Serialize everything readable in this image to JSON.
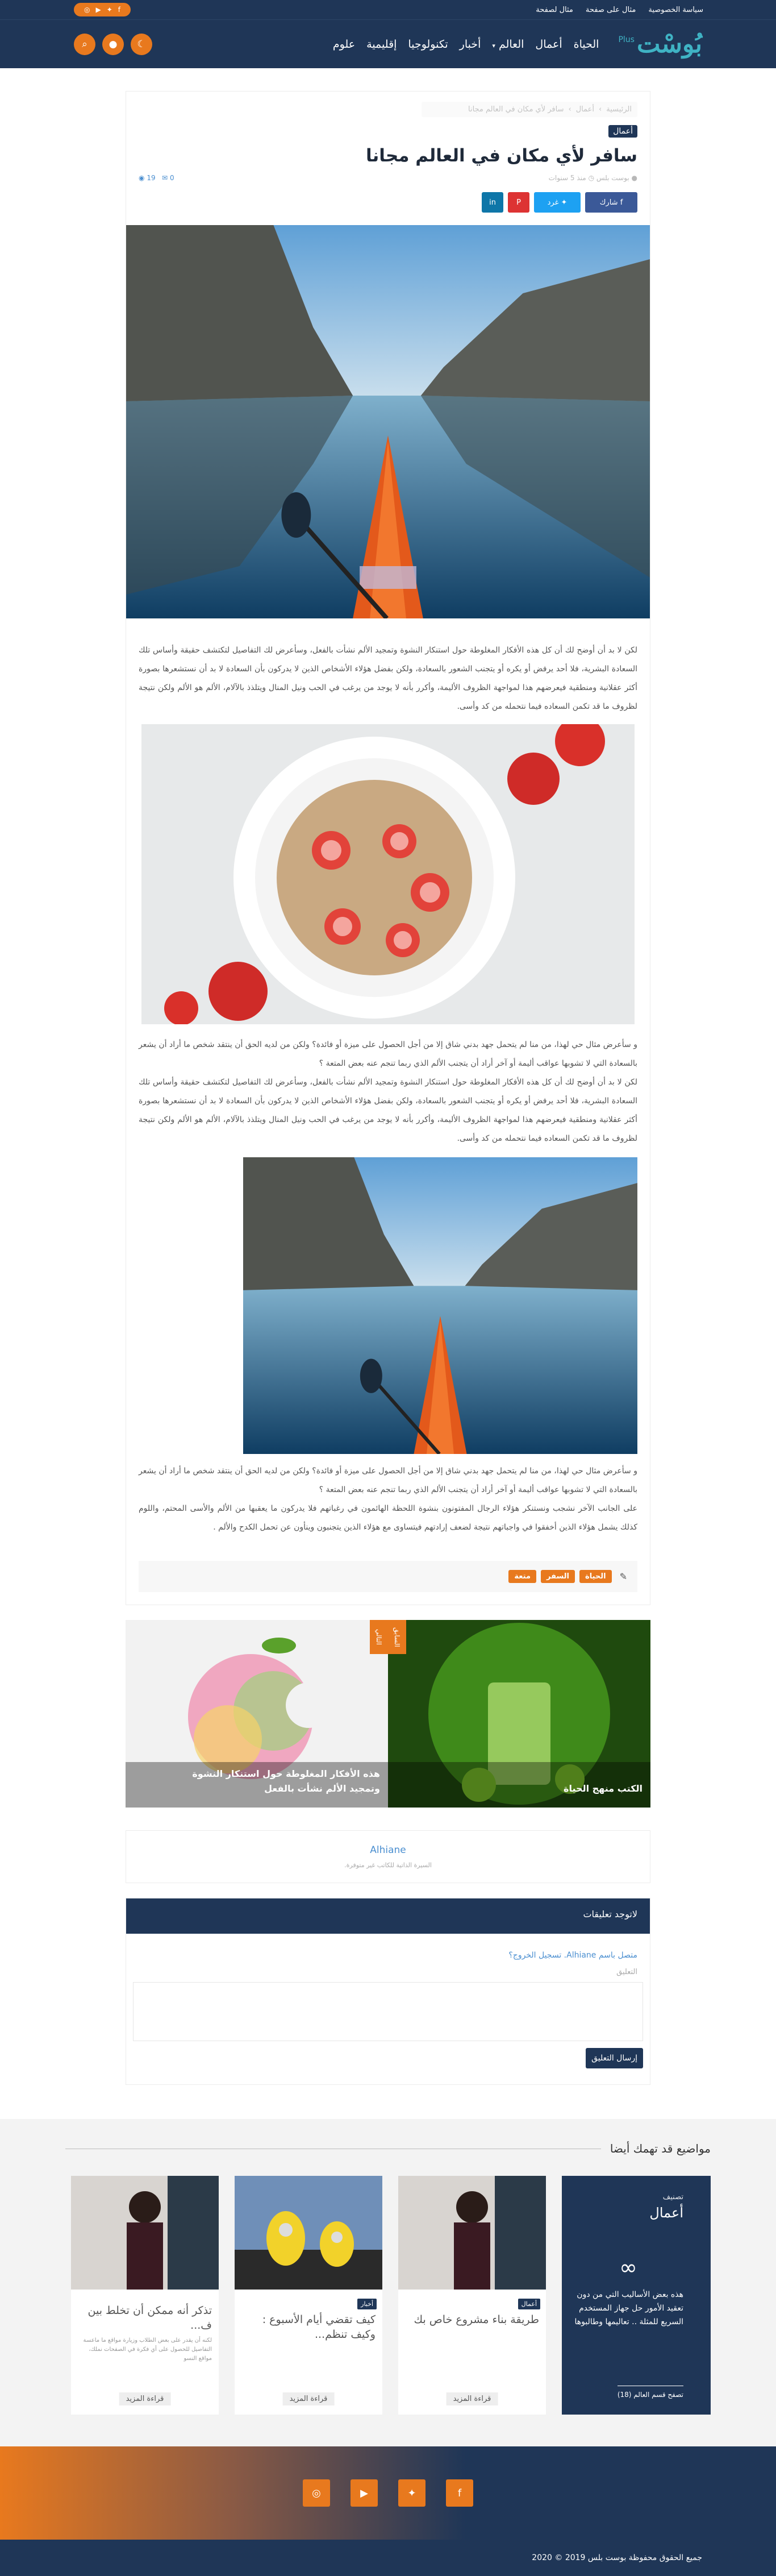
{
  "topbar": {
    "links": [
      "سياسة الخصوصية",
      "مثال على صفحة",
      "مثال لصفحة"
    ],
    "social_icons": [
      "facebook-icon",
      "twitter-icon",
      "youtube-icon",
      "instagram-icon"
    ]
  },
  "header": {
    "logo": "بُوسْت",
    "logo_plus": "Plus",
    "nav": [
      "الحياة",
      "أعمال",
      "العالم",
      "أخبار",
      "تكنولوجيا",
      "إقليمية",
      "علوم"
    ],
    "nav_dropdown": [
      false,
      false,
      true,
      false,
      false,
      false,
      false
    ],
    "buttons": [
      "moon-icon",
      "user-icon",
      "search-icon"
    ]
  },
  "post": {
    "breadcrumb": [
      "الرئيسية",
      "أعمال",
      "سافر لأي مكان في العالم مجانا"
    ],
    "tag": "أعمال",
    "title": "سافر لأي مكان في العالم مجانا",
    "author": "بوست بلس",
    "date": "منذ 5 سنوات",
    "stats_views": "19",
    "stats_comments": "0",
    "share": {
      "fb": "شارك",
      "tw": "غرد"
    },
    "paragraphs": [
      "لكن لا بد أن أوضح لك أن كل هذه الأفكار المغلوطة حول استنكار النشوة وتمجيد الألم نشأت بالفعل، وسأعرض لك التفاصيل لتكتشف حقيقة وأساس تلك السعادة البشرية، فلا أحد يرفض أو يكره أو يتجنب الشعور بالسعادة، ولكن بفضل هؤلاء الأشخاص الذين لا يدركون بأن السعادة لا بد أن نستشعرها بصورة أكثر عقلانية ومنطقية فيعرضهم هذا لمواجهة الظروف الأليمة، وأكرر بأنه لا يوجد من يرغب في الحب ونيل المنال ويتلذذ بالآلام، الألم هو الألم ولكن نتيجة لظروف ما قد تكمن السعاده فيما نتحمله من كد وأسى.",
      "و سأعرض مثال حي لهذا، من منا لم يتحمل جهد بدني شاق إلا من أجل الحصول على ميزة أو فائدة؟ ولكن من لديه الحق أن ينتقد شخص ما أراد أن يشعر بالسعادة التي لا تشوبها عواقب أليمة أو آخر أراد أن يتجنب الألم الذي ربما تنجم عنه بعض المتعة ؟",
      "لكن لا بد أن أوضح لك أن كل هذه الأفكار المغلوطة حول استنكار النشوة وتمجيد الألم نشأت بالفعل، وسأعرض لك التفاصيل لتكتشف حقيقة وأساس تلك السعادة البشرية، فلا أحد يرفض أو يكره أو يتجنب الشعور بالسعادة، ولكن بفضل هؤلاء الأشخاص الذين لا يدركون بأن السعادة لا بد أن نستشعرها بصورة أكثر عقلانية ومنطقية فيعرضهم هذا لمواجهة الظروف الأليمة، وأكرر بأنه لا يوجد من يرغب في الحب ونيل المنال ويتلذذ بالآلام، الألم هو الألم ولكن نتيجة لظروف ما قد تكمن السعاده فيما نتحمله من كد وأسى.",
      "و سأعرض مثال حي لهذا، من منا لم يتحمل جهد بدني شاق إلا من أجل الحصول على ميزة أو فائدة؟ ولكن من لديه الحق أن ينتقد شخص ما أراد أن يشعر بالسعادة التي لا تشوبها عواقب أليمة أو آخر أراد أن يتجنب الألم الذي ربما تنجم عنه بعض المتعة ؟",
      "على الجانب الآخر نشجب ونستنكر هؤلاء الرجال المفتونون بنشوة اللحظة الهائمون في رغباتهم فلا يدركون ما يعقبها من الألم والأسى المحتم، واللوم كذلك يشمل هؤلاء الذين أخفقوا في واجباتهم نتيجة لضعف إرادتهم فيتساوى مع هؤلاء الذين يتجنبون وينأون عن تحمل الكدح والألم ."
    ],
    "tags": [
      "الحياة",
      "السفر",
      "متعة"
    ]
  },
  "related": [
    {
      "title": "الكتب منهج الحياة",
      "side": "السابق"
    },
    {
      "title": "هذه الأفكار المغلوطة حول استنكار النشوة وتمجيد الألم نشأت بالفعل",
      "side": "التالي"
    }
  ],
  "author": {
    "name": "Alhiane",
    "subtitle": "السيرة الذاتية للكاتب غير متوفرة."
  },
  "comments": {
    "header": "لاتوجد تعليقات",
    "login": "متصل باسم Alhiane. تسجيل الخروج؟",
    "label": "التعليق",
    "submit": "إرسال التعليق"
  },
  "more": {
    "title": "مواضيع قد تهمك أيضا",
    "featured": {
      "cat_label": "تصنيف",
      "cat": "أعمال",
      "desc": "هذه بعض الأساليب التي من دون تعقيد الأمور حل جهاز المستخدم السريع للمثلة .. تعاليمها وطالبوها",
      "link": "تصفح قسم العالم (18)"
    },
    "posts": [
      {
        "badge": "أعمال",
        "title": "طريقة بناء مشروع خاص بك",
        "excerpt": "",
        "read": "قراءة المزيد"
      },
      {
        "badge": "أخبار",
        "title": "كيف تقضي أيام الأسبوع : وكيف تنظم...",
        "excerpt": "",
        "read": "قراءة المزيد"
      },
      {
        "badge": "",
        "title": "تذكر أنه ممكن أن تخلط بين ف...",
        "excerpt": "لكنه أن يقدر على بعض الطلاب وزيارة مواقع ما ماعسة التفاصيل للحصول على أي فكرة في الصفحات نملك، مواقع النسو",
        "read": "قراءة المزيد"
      }
    ]
  },
  "footer": {
    "social_icons": [
      "facebook-icon",
      "twitter-icon",
      "youtube-icon",
      "instagram-icon"
    ],
    "copyright": "جميع الحقوق محفوظة بوست بلس 2019 © 2020"
  }
}
